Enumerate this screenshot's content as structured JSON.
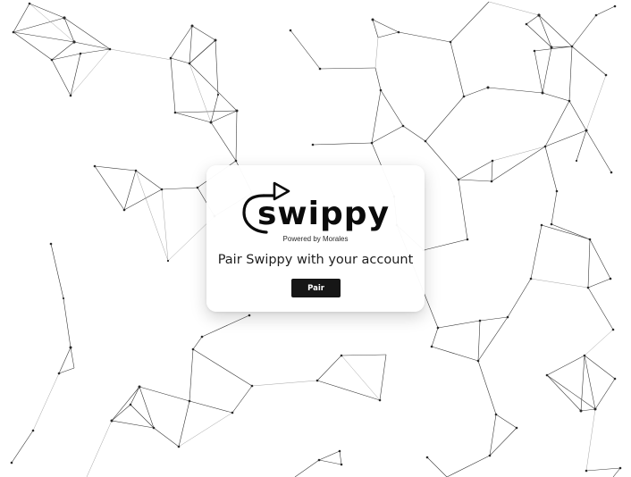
{
  "logo": {
    "wordmark": "swippy",
    "tagline": "Powered by Morales"
  },
  "pair_panel": {
    "headline": "Pair Swippy with your account",
    "pair_button_label": "Pair"
  },
  "colors": {
    "background": "#ffffff",
    "button_background": "#161616",
    "button_text": "#ffffff",
    "text": "#1e1e1e",
    "network_lines": "#3a3a3a"
  }
}
